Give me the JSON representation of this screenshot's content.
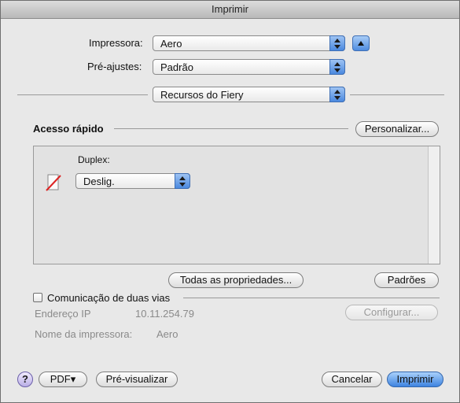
{
  "window": {
    "title": "Imprimir"
  },
  "printer": {
    "label": "Impressora:",
    "value": "Aero"
  },
  "presets": {
    "label": "Pré-ajustes:",
    "value": "Padrão"
  },
  "section": {
    "value": "Recursos do Fiery"
  },
  "quick_access": {
    "heading": "Acesso rápido",
    "customize_label": "Personalizar...",
    "duplex_label": "Duplex:",
    "duplex_value": "Deslig.",
    "duplex_icon": "no-duplex-icon"
  },
  "buttons": {
    "all_properties": "Todas as propriedades...",
    "defaults": "Padrões",
    "configure": "Configurar...",
    "pdf": "PDF▾",
    "preview": "Pré-visualizar",
    "cancel": "Cancelar",
    "print": "Imprimir",
    "help": "?"
  },
  "two_way": {
    "label": "Comunicação de duas vias",
    "ip_label": "Endereço IP",
    "ip_value": "10.11.254.79",
    "printer_name_label": "Nome da impressora:",
    "printer_name_value": "Aero"
  },
  "colors": {
    "accent": "#4b89df",
    "disabled_text": "#8a8a8a"
  }
}
